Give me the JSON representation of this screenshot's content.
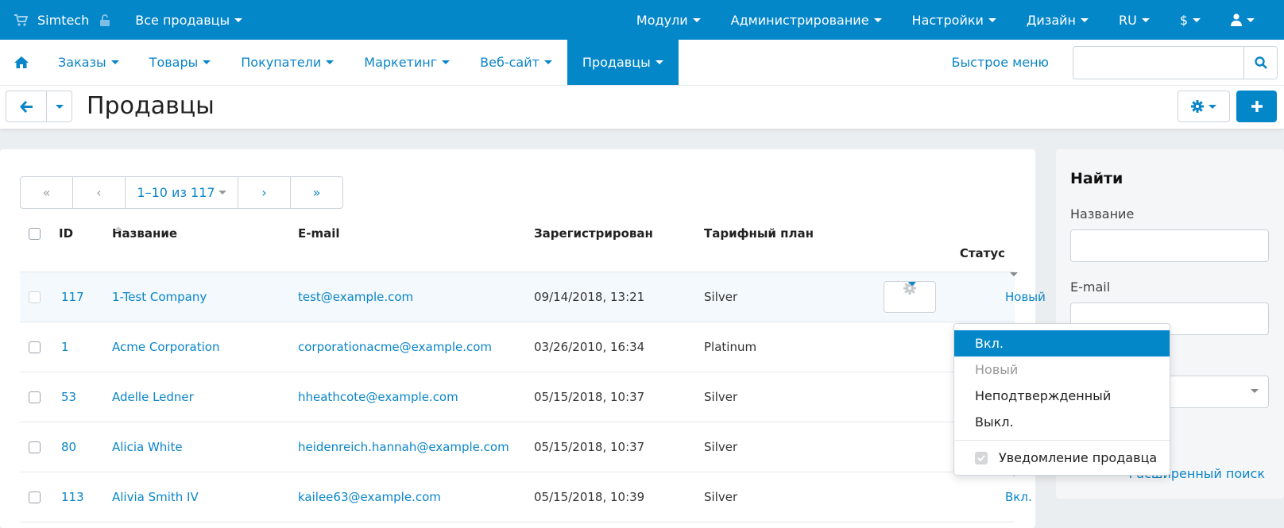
{
  "topbar": {
    "store_name": "Simtech",
    "vendor_selector": "Все продавцы",
    "menu": [
      {
        "label": "Модули"
      },
      {
        "label": "Администрирование"
      },
      {
        "label": "Настройки"
      },
      {
        "label": "Дизайн"
      },
      {
        "label": "RU"
      },
      {
        "label": "$"
      }
    ]
  },
  "nav": {
    "tabs": [
      {
        "label": "Заказы"
      },
      {
        "label": "Товары"
      },
      {
        "label": "Покупатели"
      },
      {
        "label": "Маркетинг"
      },
      {
        "label": "Веб-сайт"
      },
      {
        "label": "Продавцы",
        "active": true
      }
    ],
    "quick_menu": "Быстрое меню",
    "search_placeholder": ""
  },
  "page": {
    "title": "Продавцы"
  },
  "pagination": {
    "first": "«",
    "prev": "‹",
    "range": "1–10 из 117",
    "next": "›",
    "last": "»"
  },
  "table": {
    "columns": {
      "id": "ID",
      "name": "Название",
      "email": "E-mail",
      "registered": "Зарегистрирован",
      "plan": "Тарифный план",
      "status": "Статус"
    },
    "rows": [
      {
        "id": "117",
        "name": "1-Test Company",
        "email": "test@example.com",
        "registered": "09/14/2018, 13:21",
        "plan": "Silver",
        "status": "Новый"
      },
      {
        "id": "1",
        "name": "Acme Corporation",
        "email": "corporationacme@example.com",
        "registered": "03/26/2010, 16:34",
        "plan": "Platinum",
        "status": ""
      },
      {
        "id": "53",
        "name": "Adelle Ledner",
        "email": "hheathcote@example.com",
        "registered": "05/15/2018, 10:37",
        "plan": "Silver",
        "status": ""
      },
      {
        "id": "80",
        "name": "Alicia White",
        "email": "heidenreich.hannah@example.com",
        "registered": "05/15/2018, 10:37",
        "plan": "Silver",
        "status": ""
      },
      {
        "id": "113",
        "name": "Alivia Smith IV",
        "email": "kailee63@example.com",
        "registered": "05/15/2018, 10:39",
        "plan": "Silver",
        "status": "Вкл."
      }
    ]
  },
  "status_dropdown": {
    "options": [
      {
        "label": "Вкл.",
        "state": "highlighted"
      },
      {
        "label": "Новый",
        "state": "disabled"
      },
      {
        "label": "Неподтвержденный",
        "state": "normal"
      },
      {
        "label": "Выкл.",
        "state": "normal"
      }
    ],
    "notify_label": "Уведомление продавца",
    "notify_checked": true
  },
  "sidebar": {
    "title": "Найти",
    "name_label": "Название",
    "email_label": "E-mail",
    "advanced_search": "Расширенный поиск"
  },
  "colors": {
    "primary": "#0487c9",
    "link": "#0a85c8"
  }
}
